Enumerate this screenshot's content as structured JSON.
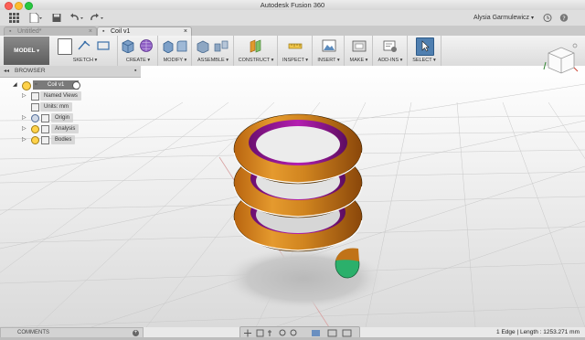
{
  "window": {
    "title": "Autodesk Fusion 360",
    "user_name": "Alysia Garmulewicz"
  },
  "document_tabs": [
    {
      "label": "Untitled*"
    },
    {
      "label": "Coil v1"
    }
  ],
  "toolbar": {
    "workspace_label": "MODEL",
    "groups": [
      {
        "label": "SKETCH ▾"
      },
      {
        "label": "CREATE ▾"
      },
      {
        "label": "MODIFY ▾"
      },
      {
        "label": "ASSEMBLE ▾"
      },
      {
        "label": "CONSTRUCT ▾"
      },
      {
        "label": "INSPECT ▾"
      },
      {
        "label": "INSERT ▾"
      },
      {
        "label": "MAKE ▾"
      },
      {
        "label": "ADD-INS ▾"
      },
      {
        "label": "SELECT ▾"
      }
    ]
  },
  "browser": {
    "title": "BROWSER",
    "root": "Coil v1",
    "items": [
      {
        "label": "Named Views"
      },
      {
        "label": "Units: mm"
      },
      {
        "label": "Origin"
      },
      {
        "label": "Analysis"
      },
      {
        "label": "Bodies"
      }
    ]
  },
  "comments": {
    "title": "COMMENTS"
  },
  "status": {
    "text": "1 Edge | Length : 1253.271 mm"
  },
  "colors": {
    "accent": "#4f7fb0",
    "coil_outer": "#d98b1e",
    "coil_inner": "#a01fa0",
    "end_face": "#2bb06b"
  }
}
